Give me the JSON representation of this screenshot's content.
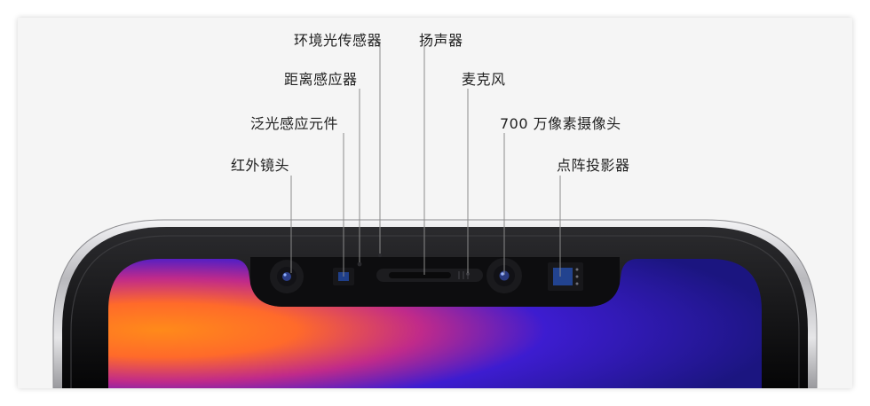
{
  "labels": {
    "infrared_camera": "红外镜头",
    "flood_illuminator": "泛光感应元件",
    "proximity_sensor": "距离感应器",
    "ambient_light_sensor": "环境光传感器",
    "speaker": "扬声器",
    "microphone": "麦克风",
    "front_camera": "700 万像素摄像头",
    "dot_projector": "点阵投影器"
  },
  "colors": {
    "panel_bg": "#f5f5f5",
    "phone_body": "#0b0b0c",
    "steel_frame": "#c8c8ca",
    "leader_line": "#8a8a8a",
    "screen_orange": "#ff7a1c",
    "screen_blue": "#2a19c9"
  }
}
